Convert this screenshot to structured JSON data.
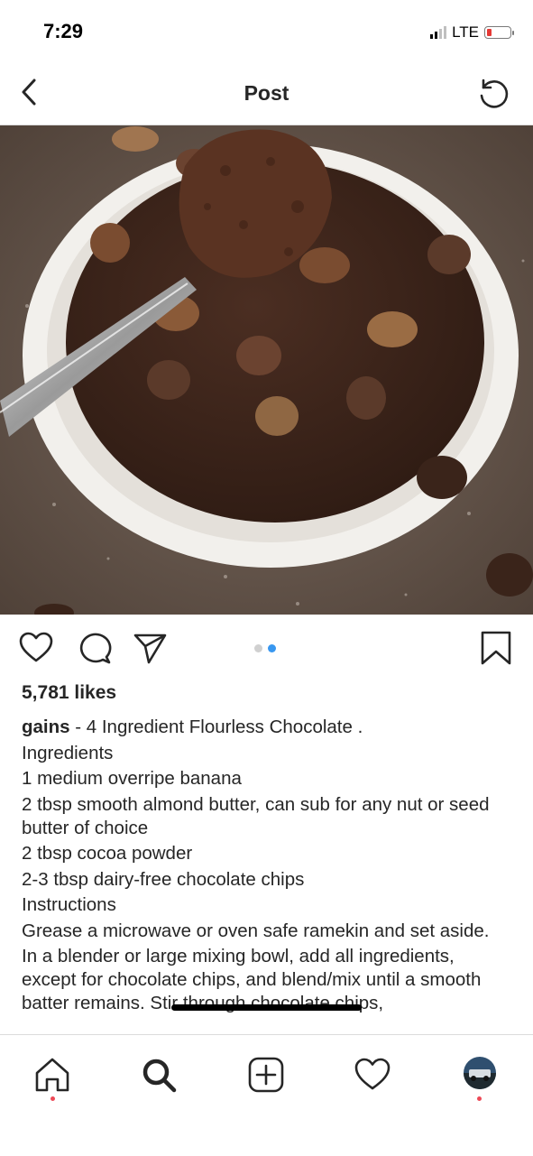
{
  "status_bar": {
    "time": "7:29",
    "network": "LTE",
    "battery_level": 0.15
  },
  "nav": {
    "title": "Post"
  },
  "post": {
    "carousel": {
      "count": 2,
      "active_index": 1
    },
    "likes": "5,781 likes",
    "caption": {
      "username": "gains",
      "text": " - 4 Ingredient Flourless Chocolate .",
      "lines": [
        "Ingredients",
        "1 medium overripe banana",
        "2 tbsp smooth almond butter, can sub for any nut or seed butter of choice",
        "2 tbsp cocoa powder",
        "2-3 tbsp dairy-free chocolate chips",
        "Instructions",
        "Grease a microwave or oven safe ramekin and set aside.",
        "In a blender or large mixing bowl, add all ingredients, except for chocolate chips, and blend/mix until a smooth batter remains. Stir through chocolate chips,"
      ]
    }
  },
  "icons": {
    "back": "chevron-left-icon",
    "refresh": "refresh-icon",
    "like": "heart-icon",
    "comment": "comment-icon",
    "share": "send-icon",
    "save": "bookmark-icon",
    "home": "home-icon",
    "search": "search-icon",
    "create": "add-post-icon",
    "activity": "heart-icon",
    "profile": "avatar"
  },
  "colors": {
    "accent": "#3897f0",
    "notification": "#ed4956",
    "text": "#262626",
    "divider": "#dbdbdb"
  }
}
